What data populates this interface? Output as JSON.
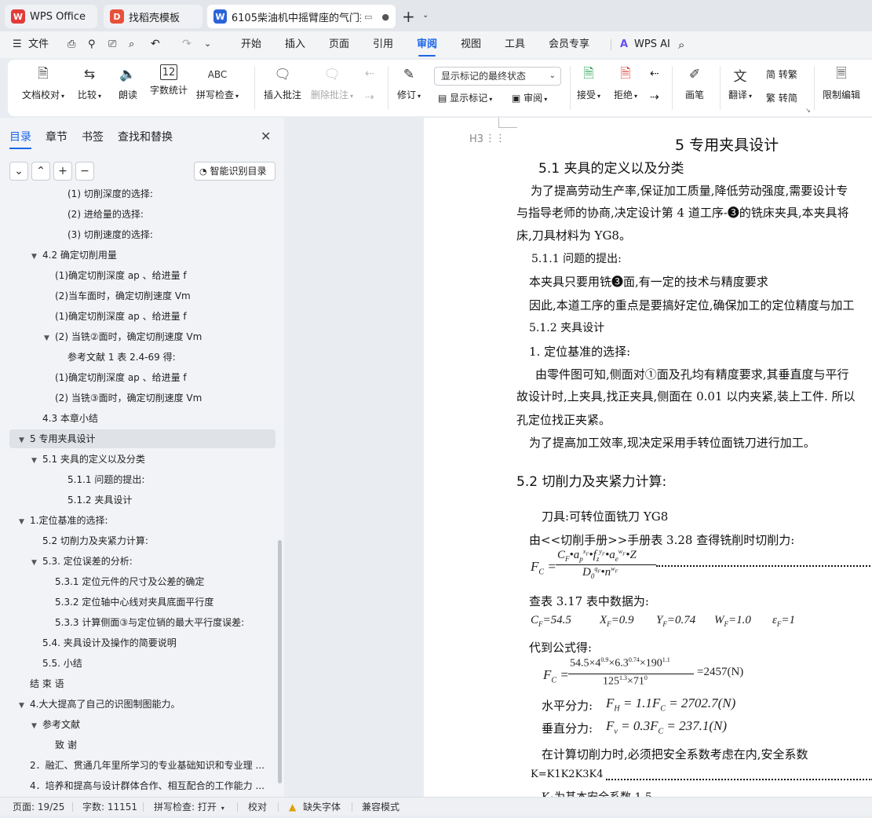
{
  "tabs": [
    {
      "label": "WPS Office",
      "icon": "wps-icon"
    },
    {
      "label": "找稻壳模板",
      "icon": "docer-icon"
    },
    {
      "label": "6105柴油机中摇臂座的气门摇",
      "icon": "word-doc-icon"
    }
  ],
  "menu": {
    "file": "文件",
    "items": [
      "开始",
      "插入",
      "页面",
      "引用",
      "审阅",
      "视图",
      "工具",
      "会员专享"
    ],
    "active": "审阅",
    "ai": "WPS AI"
  },
  "ribbon": {
    "doc_check": "文档校对",
    "compare": "比较",
    "read_aloud": "朗读",
    "word_count": "字数统计",
    "spell_check": "拼写检查",
    "insert_comment": "插入批注",
    "delete_comment": "删除批注",
    "revise": "修订",
    "markup_mode": "显示标记的最终状态",
    "show_markup": "显示标记",
    "review": "审阅",
    "accept": "接受",
    "reject": "拒绝",
    "pen": "画笔",
    "translate": "翻译",
    "to_traditional": "简 转繁",
    "to_simplified": "繁 转简",
    "restrict_edit": "限制编辑",
    "word_count_icon_text": "12",
    "spell_icon_text": "ABC"
  },
  "sidebar": {
    "tabs": [
      "目录",
      "章节",
      "书签",
      "查找和替换"
    ],
    "smart_toc": "智能识别目录",
    "toc": [
      {
        "text": "(1) 切削深度的选择:",
        "level": 3
      },
      {
        "text": "(2) 进给量的选择:",
        "level": 3
      },
      {
        "text": "(3) 切削速度的选择:",
        "level": 3
      },
      {
        "text": "4.2  确定切削用量",
        "level": 1,
        "expand": true
      },
      {
        "text": "(1)确定切削深度 ap 、给进量 f",
        "level": 2
      },
      {
        "text": "(2)当车面时，确定切削速度 Vm",
        "level": 2
      },
      {
        "text": "(1)确定切削深度 ap 、给进量 f",
        "level": 2
      },
      {
        "text": "(2) 当铣②面时，确定切削速度 Vm",
        "level": 2,
        "expand": true
      },
      {
        "text": "参考文献 1 表 2.4-69 得:",
        "level": 3
      },
      {
        "text": "(1)确定切削深度 ap 、给进量 f",
        "level": 2
      },
      {
        "text": "(2) 当铣③面时，确定切削速度 Vm",
        "level": 2
      },
      {
        "text": "4.3  本章小结",
        "level": 1
      },
      {
        "text": "5  专用夹具设计",
        "level": 0,
        "expand": true,
        "selected": true
      },
      {
        "text": "5.1 夹具的定义以及分类",
        "level": 1,
        "expand": true
      },
      {
        "text": "5.1.1 问题的提出:",
        "level": 3
      },
      {
        "text": "5.1.2  夹具设计",
        "level": 3
      },
      {
        "text": "1.定位基准的选择:",
        "level": 0,
        "expand": true
      },
      {
        "text": "5.2 切削力及夹紧力计算:",
        "level": 1
      },
      {
        "text": "5.3.  定位误差的分析:",
        "level": 1,
        "expand": true
      },
      {
        "text": "5.3.1 定位元件的尺寸及公差的确定",
        "level": 2
      },
      {
        "text": "5.3.2 定位轴中心线对夹具底面平行度",
        "level": 2
      },
      {
        "text": "5.3.3 计算侧面③与定位销的最大平行度误差:",
        "level": 2
      },
      {
        "text": "5.4.  夹具设计及操作的简要说明",
        "level": 1
      },
      {
        "text": "5.5.  小结",
        "level": 1
      },
      {
        "text": "结 束 语",
        "level": 0
      },
      {
        "text": "4.大大提高了自己的识图制图能力。",
        "level": 0,
        "expand": true
      },
      {
        "text": "参考文献",
        "level": 1,
        "expand": true
      },
      {
        "text": "致 谢",
        "level": 2
      },
      {
        "text": "2．融汇、贯通几年里所学习的专业基础知识和专业理 ...",
        "level": 0
      },
      {
        "text": "4．培养和提高与设计群体合作、相互配合的工作能力 ...",
        "level": 0
      }
    ]
  },
  "document": {
    "heading_marker": "H3",
    "chapter_title": "5   专用夹具设计",
    "section_5_1": "5.1 夹具的定义以及分类",
    "p1_line1": "为了提高劳动生产率,保证加工质量,降低劳动强度,需要设计专",
    "p1_line2": "与指导老师的协商,决定设计第 4 道工序-❸的铣床夹具,本夹具将",
    "p1_line3": "床,刀具材料为 YG8。",
    "sub_5_1_1": "5.1.1 问题的提出:",
    "p2": "本夹具只要用铣❸面,有一定的技术与精度要求",
    "p3": "因此,本道工序的重点是要搞好定位,确保加工的定位精度与加工",
    "sub_5_1_2": "5.1.2   夹具设计",
    "item1": "1. 定位基准的选择:",
    "p4_line1": "由零件图可知,侧面对①面及孔均有精度要求,其垂直度与平行",
    "p4_line2": "故设计时,上夹具,找正夹具,侧面在 0.01 以内夹紧,装上工件. 所以",
    "p4_line3": "孔定位找正夹紧。",
    "p5": "为了提高加工效率,现决定采用手转位面铣刀进行加工。",
    "section_5_2": "5.2 切削力及夹紧力计算:",
    "tool": "刀具:可转位面铣刀      YG8",
    "lookup": "由<<切削手册>>手册表 3.28 查得铣削时切削力:",
    "formula_lhs": "F",
    "formula_num": "C_F·a_p^{x_F}·f_z^{y_F}·a_e^{w_F}·Z",
    "formula_den": "D_0^{q_F}·n^{w_F}",
    "table_lookup": "查表 3.17 表中数据为:",
    "params": [
      "C_F =54.5",
      "X_F =0.9",
      "Y_F =0.74",
      "W_F =1.0",
      "ε_F =1"
    ],
    "substitute": "代到公式得:",
    "calc_num": "54.5×4^0.9×6.3^0.74×190^1.1",
    "calc_den": "125^1.3×71^0",
    "calc_result": "=2457(N)",
    "horizontal_label": "水平分力:",
    "horizontal_formula": "F_H = 1.1F_C = 2702.7(N)",
    "vertical_label": "垂直分力:",
    "vertical_formula": "F_v = 0.3F_C = 237.1(N)",
    "safety_text": "在计算切削力时,必须把安全系数考虑在内,安全系数",
    "k_formula": "K=K1K2K3K4",
    "k1_text": "K₁为基本安全系数 1.5"
  },
  "status": {
    "page": "页面: 19/25",
    "words": "字数: 11151",
    "spell": "拼写检查: 打开",
    "proof": "校对",
    "missing_font": "缺失字体",
    "compat": "兼容模式"
  },
  "colors": {
    "accent": "#1a66e8",
    "wps_red": "#e23b3b",
    "doc_blue": "#2b63d9"
  }
}
